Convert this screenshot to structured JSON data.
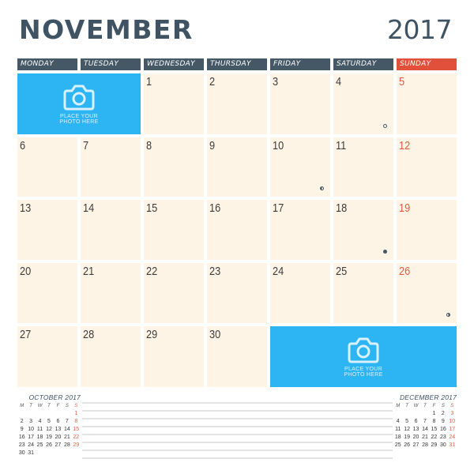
{
  "header": {
    "month": "NOVEMBER",
    "year": "2017"
  },
  "weekdays": [
    {
      "label": "MONDAY",
      "sunday": false
    },
    {
      "label": "TUESDAY",
      "sunday": false
    },
    {
      "label": "WEDNESDAY",
      "sunday": false
    },
    {
      "label": "THURSDAY",
      "sunday": false
    },
    {
      "label": "FRIDAY",
      "sunday": false
    },
    {
      "label": "SATURDAY",
      "sunday": false
    },
    {
      "label": "SUNDAY",
      "sunday": true
    }
  ],
  "colors": {
    "header_bg": "#445866",
    "sunday_accent": "#e1503a",
    "cell_bg": "#fdf4e6",
    "photo_bg": "#2db5f3",
    "title": "#3f5362"
  },
  "photo_placeholders": [
    {
      "label_line1": "PLACE YOUR",
      "label_line2": "PHOTO HERE",
      "icon": "camera-icon"
    },
    {
      "label_line1": "PLACE YOUR",
      "label_line2": "PHOTO HERE",
      "icon": "camera-icon"
    }
  ],
  "days": [
    {
      "day": "1",
      "col": 2,
      "row": 0
    },
    {
      "day": "2",
      "col": 3,
      "row": 0
    },
    {
      "day": "3",
      "col": 4,
      "row": 0
    },
    {
      "day": "4",
      "col": 5,
      "row": 0,
      "moon": "full"
    },
    {
      "day": "5",
      "col": 6,
      "row": 0
    },
    {
      "day": "6",
      "col": 0,
      "row": 1
    },
    {
      "day": "7",
      "col": 1,
      "row": 1
    },
    {
      "day": "8",
      "col": 2,
      "row": 1
    },
    {
      "day": "9",
      "col": 3,
      "row": 1
    },
    {
      "day": "10",
      "col": 4,
      "row": 1,
      "moon": "last"
    },
    {
      "day": "11",
      "col": 5,
      "row": 1
    },
    {
      "day": "12",
      "col": 6,
      "row": 1
    },
    {
      "day": "13",
      "col": 0,
      "row": 2
    },
    {
      "day": "14",
      "col": 1,
      "row": 2
    },
    {
      "day": "15",
      "col": 2,
      "row": 2
    },
    {
      "day": "16",
      "col": 3,
      "row": 2
    },
    {
      "day": "17",
      "col": 4,
      "row": 2
    },
    {
      "day": "18",
      "col": 5,
      "row": 2,
      "moon": "new"
    },
    {
      "day": "19",
      "col": 6,
      "row": 2
    },
    {
      "day": "20",
      "col": 0,
      "row": 3
    },
    {
      "day": "21",
      "col": 1,
      "row": 3
    },
    {
      "day": "22",
      "col": 2,
      "row": 3
    },
    {
      "day": "23",
      "col": 3,
      "row": 3
    },
    {
      "day": "24",
      "col": 4,
      "row": 3
    },
    {
      "day": "25",
      "col": 5,
      "row": 3
    },
    {
      "day": "26",
      "col": 6,
      "row": 3,
      "moon": "first"
    },
    {
      "day": "27",
      "col": 0,
      "row": 4
    },
    {
      "day": "28",
      "col": 1,
      "row": 4
    },
    {
      "day": "29",
      "col": 2,
      "row": 4
    },
    {
      "day": "30",
      "col": 3,
      "row": 4
    }
  ],
  "mini_calendars": [
    {
      "title": "OCTOBER 2017",
      "weekday_initials": [
        "M",
        "T",
        "W",
        "T",
        "F",
        "S",
        "S"
      ],
      "weeks": [
        [
          "",
          "",
          "",
          "",
          "",
          "",
          "1"
        ],
        [
          "2",
          "3",
          "4",
          "5",
          "6",
          "7",
          "8"
        ],
        [
          "9",
          "10",
          "11",
          "12",
          "13",
          "14",
          "15"
        ],
        [
          "16",
          "17",
          "18",
          "19",
          "20",
          "21",
          "22"
        ],
        [
          "23",
          "24",
          "25",
          "26",
          "27",
          "28",
          "29"
        ],
        [
          "30",
          "31",
          "",
          "",
          "",
          "",
          ""
        ]
      ]
    },
    {
      "title": "DECEMBER 2017",
      "weekday_initials": [
        "M",
        "T",
        "W",
        "T",
        "F",
        "S",
        "S"
      ],
      "weeks": [
        [
          "",
          "",
          "",
          "",
          "1",
          "2",
          "3"
        ],
        [
          "4",
          "5",
          "6",
          "7",
          "8",
          "9",
          "10"
        ],
        [
          "11",
          "12",
          "13",
          "14",
          "15",
          "16",
          "17"
        ],
        [
          "18",
          "19",
          "20",
          "21",
          "22",
          "23",
          "24"
        ],
        [
          "25",
          "26",
          "27",
          "28",
          "29",
          "30",
          "31"
        ]
      ]
    }
  ],
  "notes": {
    "line_count": 8
  }
}
